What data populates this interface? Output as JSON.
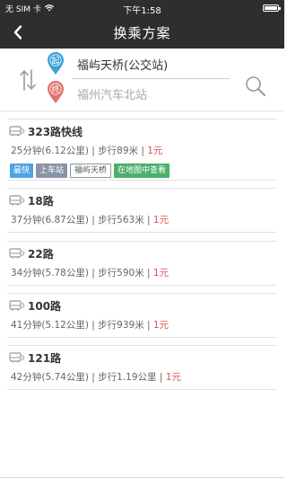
{
  "status": {
    "carrier": "无 SIM 卡",
    "time": "下午1:58",
    "battery_level": 1.0
  },
  "nav": {
    "title": "换乘方案",
    "back_icon": "chevron-left-icon"
  },
  "route": {
    "start_badge": "起",
    "end_badge": "终",
    "from": "福屿天桥(公交站)",
    "to": "福州汽车北站",
    "start_color": "#3a9fd8",
    "end_color": "#e0716b"
  },
  "plans": [
    {
      "title": "323路快线",
      "duration": "25分钟(6.12公里)",
      "walk": "步行89米",
      "price": "1元",
      "tags": {
        "fast": "最快",
        "board": "上车站",
        "stop": "福屿天桥",
        "map": "在地图中查看"
      }
    },
    {
      "title": "18路",
      "duration": "37分钟(6.87公里)",
      "walk": "步行563米",
      "price": "1元"
    },
    {
      "title": "22路",
      "duration": "34分钟(5.78公里)",
      "walk": "步行590米",
      "price": "1元"
    },
    {
      "title": "100路",
      "duration": "41分钟(5.12公里)",
      "walk": "步行939米",
      "price": "1元"
    },
    {
      "title": "121路",
      "duration": "42分钟(5.74公里)",
      "walk": "步行1.19公里",
      "price": "1元"
    }
  ],
  "separator": " | ",
  "colors": {
    "header_bg": "#2e2e2e",
    "price": "#d9534f",
    "tag_fast": "#4fa3e0",
    "tag_board": "#8a94a6",
    "tag_map": "#4caf6a"
  }
}
